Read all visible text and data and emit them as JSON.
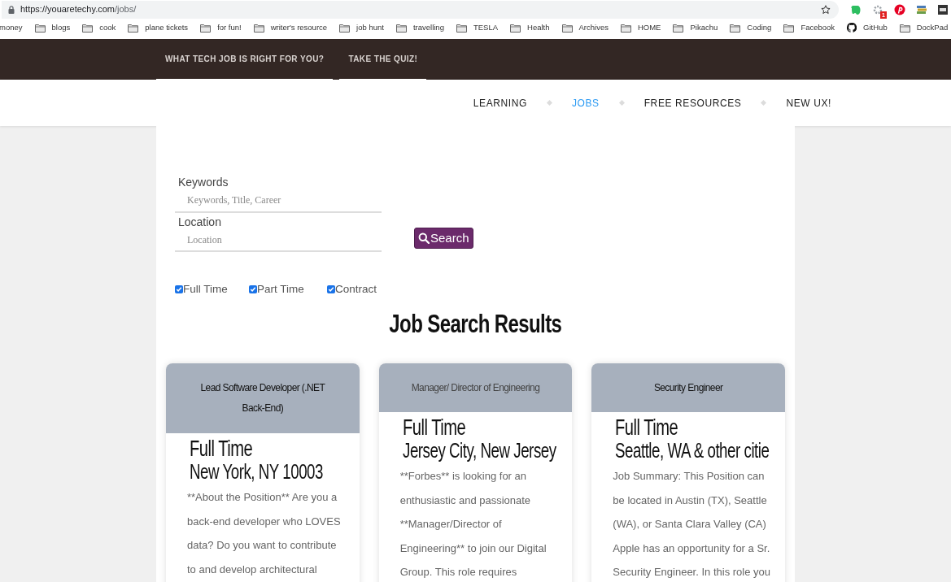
{
  "browser": {
    "url_host": "https://youaretechy.com",
    "url_path": "/jobs/",
    "extension_badge": "1",
    "bookmarks": [
      {
        "label": "money",
        "kind": "plain"
      },
      {
        "label": "blogs",
        "kind": "folder"
      },
      {
        "label": "cook",
        "kind": "folder"
      },
      {
        "label": "plane tickets",
        "kind": "folder"
      },
      {
        "label": "for fun!",
        "kind": "folder"
      },
      {
        "label": "writer's resource",
        "kind": "folder"
      },
      {
        "label": "job hunt",
        "kind": "folder"
      },
      {
        "label": "travelling",
        "kind": "folder"
      },
      {
        "label": "TESLA",
        "kind": "folder"
      },
      {
        "label": "Health",
        "kind": "folder"
      },
      {
        "label": "Archives",
        "kind": "folder"
      },
      {
        "label": "HOME",
        "kind": "folder"
      },
      {
        "label": "Pikachu",
        "kind": "folder"
      },
      {
        "label": "Coding",
        "kind": "folder"
      },
      {
        "label": "Facebook",
        "kind": "folder"
      },
      {
        "label": "GitHub",
        "kind": "github"
      },
      {
        "label": "DockPad",
        "kind": "folder"
      }
    ]
  },
  "top_bar": {
    "links": [
      "WHAT TECH JOB IS RIGHT FOR YOU?",
      "TAKE THE QUIZ!"
    ]
  },
  "nav": [
    {
      "label": "LEARNING",
      "selected": false
    },
    {
      "label": "JOBS",
      "selected": true
    },
    {
      "label": "FREE RESOURCES",
      "selected": false
    },
    {
      "label": "NEW UX!",
      "selected": false
    }
  ],
  "search_form": {
    "fields": [
      {
        "label": "Keywords",
        "placeholder": "Keywords, Title, Career"
      },
      {
        "label": "Location",
        "placeholder": "Location"
      }
    ],
    "button": "Search",
    "filters": [
      {
        "label": "Full Time",
        "checked": true
      },
      {
        "label": "Part Time",
        "checked": true
      },
      {
        "label": "Contract",
        "checked": true
      }
    ]
  },
  "results": {
    "heading": "Job Search Results",
    "jobs": [
      {
        "title": "Lead Software Developer (.NET Back-End)",
        "type": "Full Time",
        "location": "New York, NY 10003",
        "description": "**About the Position**  Are you a back-end developer who LOVES data? Do you want to contribute to and develop architectural"
      },
      {
        "title": "Manager/ Director of Engineering",
        "type": "Full Time",
        "location": "Jersey City, New Jersey",
        "description": "**Forbes** is looking for an enthusiastic and passionate **Manager/Director of Engineering** to join our Digital Group. This role requires"
      },
      {
        "title": "Security Engineer",
        "type": "Full Time",
        "location": "Seattle, WA & other citie",
        "description": "Job Summary: This Position can be located in Austin (TX), Seattle (WA), or Santa Clara Valley (CA) Apple has an opportunity for a Sr. Security Engineer. In this role you"
      }
    ]
  }
}
